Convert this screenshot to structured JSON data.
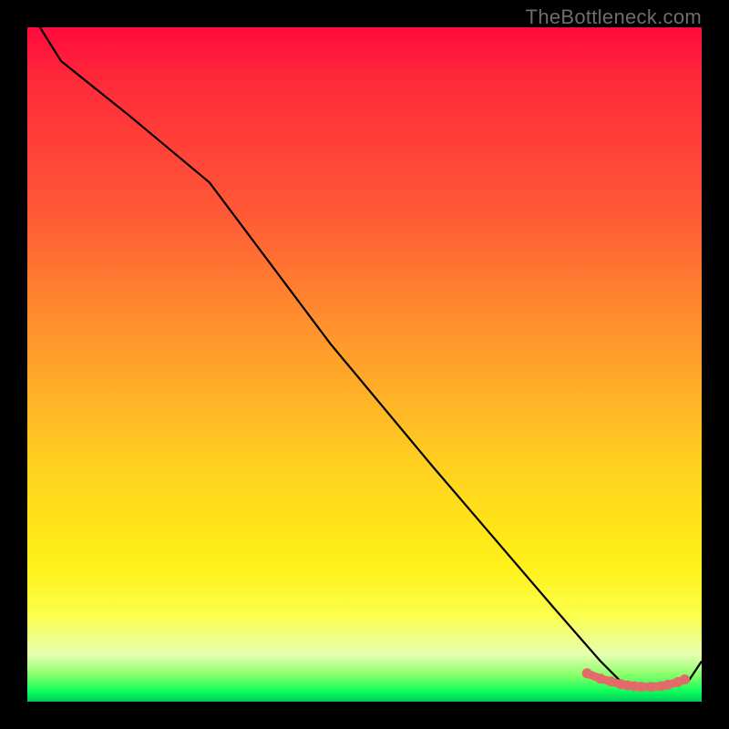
{
  "watermark": "TheBottleneck.com",
  "chart_data": {
    "type": "line",
    "title": "",
    "xlabel": "",
    "ylabel": "",
    "xlim": [
      0,
      100
    ],
    "ylim": [
      0,
      100
    ],
    "series": [
      {
        "name": "bottleneck-curve",
        "color": "#000000",
        "x": [
          0,
          5,
          15,
          27,
          45,
          60,
          78,
          85,
          88,
          91,
          94,
          98,
          100
        ],
        "values": [
          103,
          95,
          87,
          77,
          53,
          35,
          14,
          6,
          3,
          2,
          2,
          3,
          6
        ]
      }
    ],
    "highlight": {
      "name": "optimal-range",
      "color": "#e46a6a",
      "points_x": [
        83,
        85,
        86.5,
        88,
        89,
        90,
        91,
        92.5,
        94,
        95,
        96.5,
        97.5
      ],
      "points_y": [
        4.2,
        3.4,
        3.0,
        2.6,
        2.4,
        2.3,
        2.2,
        2.2,
        2.3,
        2.5,
        2.9,
        3.3
      ]
    },
    "background_gradient": {
      "stops": [
        {
          "pos": 0.0,
          "color": "#ff0a3c"
        },
        {
          "pos": 0.28,
          "color": "#ff5a36"
        },
        {
          "pos": 0.55,
          "color": "#ffb227"
        },
        {
          "pos": 0.8,
          "color": "#fff11a"
        },
        {
          "pos": 0.96,
          "color": "#8aff6a"
        },
        {
          "pos": 1.0,
          "color": "#00c85a"
        }
      ]
    }
  }
}
